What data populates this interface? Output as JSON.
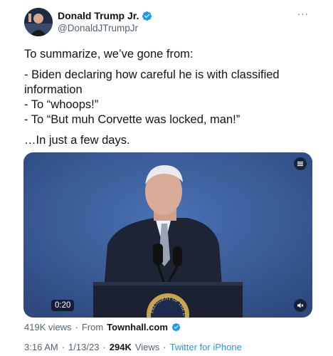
{
  "author": {
    "display_name": "Donald Trump Jr.",
    "handle": "@DonaldJTrumpJr",
    "verified": true
  },
  "more_menu_label": "···",
  "tweet": {
    "lines": [
      "To summarize, we’ve gone from:",
      "- Biden declaring how careful he is with classified information",
      "- To “whoops!”",
      "- To “But muh Corvette was locked, man!”",
      "…In just a few days."
    ]
  },
  "video": {
    "duration": "0:20",
    "podium_seal_text": "PRESIDENT OF THE UN"
  },
  "stats": {
    "views_text": "419K views",
    "from_label": "From",
    "source": "Townhall.com",
    "time": "3:16 AM",
    "date": "1/13/23",
    "view_count": "294K",
    "views_label": "Views",
    "client": "Twitter for iPhone",
    "separator": "·"
  },
  "colors": {
    "accent": "#1d9bf0",
    "secondary_text": "#536471",
    "video_bg": "#3d5f9c"
  }
}
